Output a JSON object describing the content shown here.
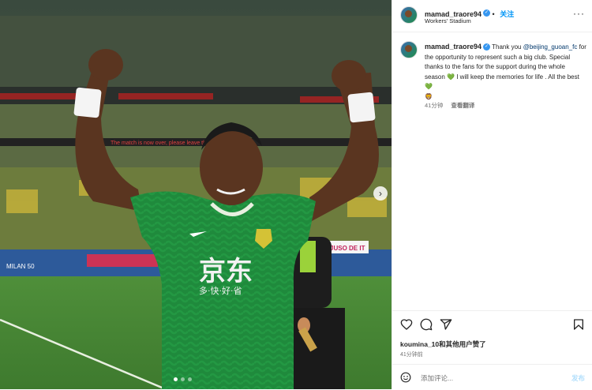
{
  "post": {
    "username": "mamad_traore94",
    "follow_label": "关注",
    "location": "Workers' Stadium",
    "more_icon": "more-dots-icon",
    "caption": {
      "username": "mamad_traore94",
      "text_1": "Thank you",
      "mention": "@beijing_guoan_fc",
      "text_2": "for the opportunity to represent such a big club. Special thanks to the fans for the support during the whole season",
      "text_3": "I will keep the memories for life . All the best",
      "heart": "💚",
      "badge": "🦁"
    },
    "timestamp": "41分钟",
    "translate_label": "查看翻译",
    "likes": "koumina_10和其他用户赞了",
    "time_ago": "41分钟前",
    "comment_placeholder": "添加评论...",
    "post_label": "发布"
  },
  "media": {
    "jersey_sponsor_cn": "京东",
    "jersey_sponsor_sub": "多·快·好·省",
    "board_left": "MILAN  50",
    "board_right": "JUSO DE IT",
    "stadium_banner": "The match is now over, please leave the stadium"
  },
  "colors": {
    "accent": "#0095f6",
    "verified": "#3797f0",
    "jersey": "#1f8a3c"
  }
}
